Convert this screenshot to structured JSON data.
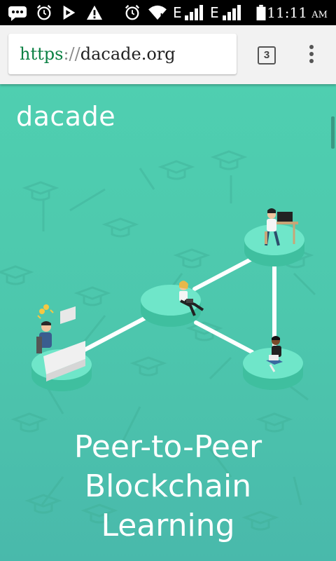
{
  "status_bar": {
    "time": "11:11",
    "ampm": "AM",
    "network_type": "E",
    "icons": [
      "messages-icon",
      "alarm-icon",
      "play-store-icon",
      "warning-icon",
      "alarm-icon",
      "wifi-icon",
      "signal-icon",
      "signal-icon",
      "battery-icon"
    ]
  },
  "browser": {
    "url_scheme": "https",
    "url_sep": "://",
    "url_host": "dacade.org",
    "tab_count": "3",
    "menu_icon": "overflow-menu-icon"
  },
  "page": {
    "logo": "dacade",
    "headline_lines": [
      "Peer-to-Peer",
      "Blockchain",
      "Learning"
    ]
  },
  "colors": {
    "page_bg_top": "#4fcfb0",
    "page_bg_bottom": "#49b9ab",
    "url_scheme_green": "#0b8043",
    "platform": "#5fe0c0"
  }
}
